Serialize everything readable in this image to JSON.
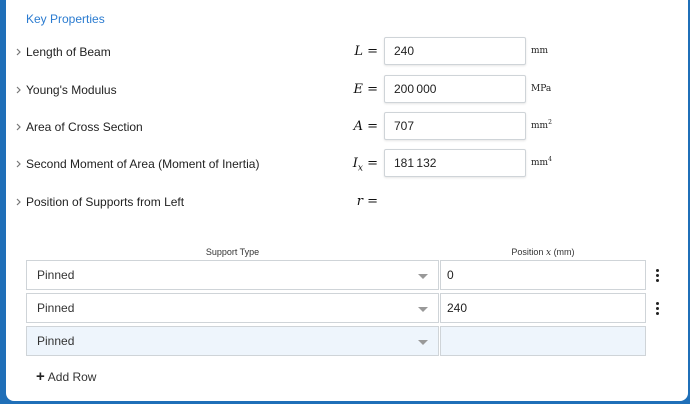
{
  "section": {
    "title": "Key Properties"
  },
  "properties": [
    {
      "label": "Length of Beam",
      "symbol": "L",
      "subscript": "",
      "eq": "=",
      "value": "240",
      "unit": "mm",
      "unit_sup": ""
    },
    {
      "label": "Young's Modulus",
      "symbol": "E",
      "subscript": "",
      "eq": "=",
      "value": "200 000",
      "unit": "MPa",
      "unit_sup": ""
    },
    {
      "label": "Area of Cross Section",
      "symbol": "A",
      "subscript": "",
      "eq": "=",
      "value": "707",
      "unit": "mm",
      "unit_sup": "2"
    },
    {
      "label": "Second Moment of Area (Moment of Inertia)",
      "symbol": "I",
      "subscript": "x",
      "eq": "=",
      "value": "181 132",
      "unit": "mm",
      "unit_sup": "4"
    },
    {
      "label": "Position of Supports from Left",
      "symbol": "r",
      "subscript": "",
      "eq": "="
    }
  ],
  "supports_table": {
    "col_support_type": "Support Type",
    "col_position_prefix": "Position",
    "col_position_var": "x",
    "col_position_unit": "(mm)",
    "rows": [
      {
        "type": "Pinned",
        "position": "0"
      },
      {
        "type": "Pinned",
        "position": "240"
      }
    ],
    "new_row": {
      "type": "Pinned",
      "position": ""
    }
  },
  "add_row_label": "Add Row",
  "colors": {
    "accent": "#2a7bd0",
    "frame": "#1f6fb8",
    "new_row_bg": "#eef5fc"
  }
}
